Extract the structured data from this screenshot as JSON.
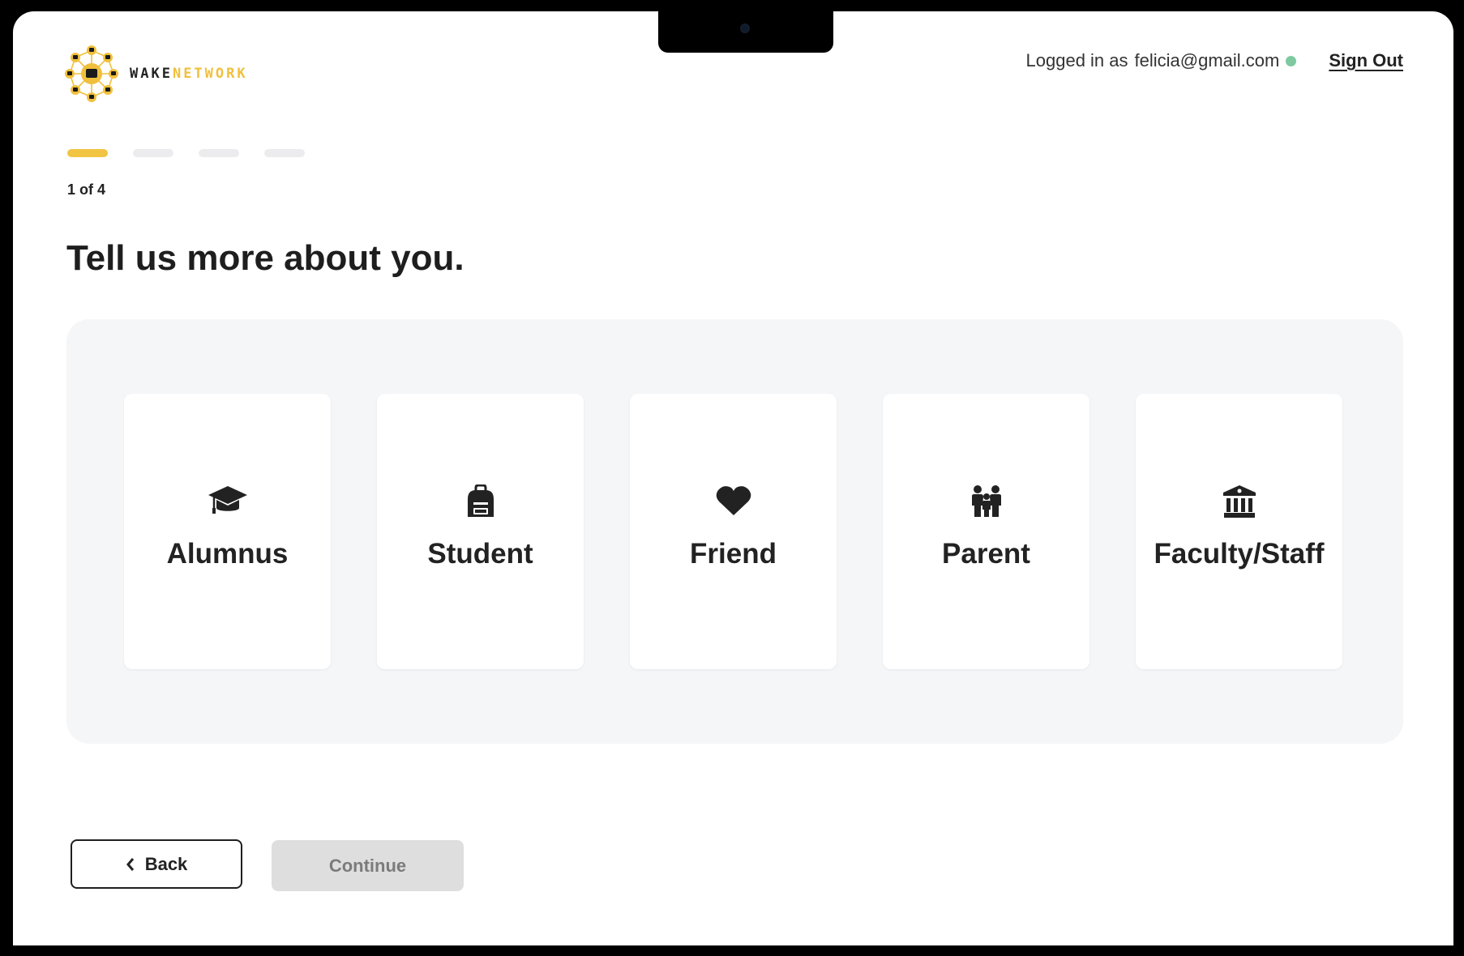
{
  "brand": {
    "name_part1": "WAKE",
    "name_part2": "NETWORK",
    "accent_color": "#f2c443",
    "logo_icon": "hub-network-logo-icon"
  },
  "header": {
    "logged_in_label": "Logged in as",
    "email": "felicia@gmail.com",
    "status_color": "#7ec9a0",
    "sign_out_label": "Sign Out"
  },
  "progress": {
    "current_step": 1,
    "total_steps": 4,
    "step_text": "1 of 4"
  },
  "main": {
    "title": "Tell us more about you.",
    "options": [
      {
        "label": "Alumnus",
        "icon": "graduation-cap-icon"
      },
      {
        "label": "Student",
        "icon": "backpack-icon"
      },
      {
        "label": "Friend",
        "icon": "heart-icon"
      },
      {
        "label": "Parent",
        "icon": "family-icon"
      },
      {
        "label": "Faculty/Staff",
        "icon": "building-columns-icon"
      }
    ]
  },
  "footer": {
    "back_label": "Back",
    "continue_label": "Continue",
    "continue_enabled": false
  }
}
